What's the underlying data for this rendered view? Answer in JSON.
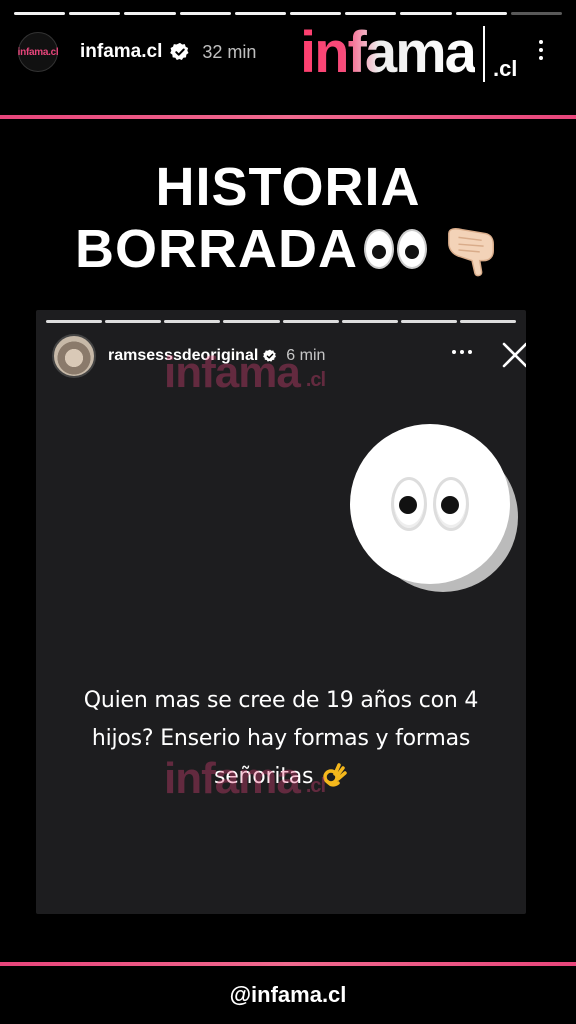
{
  "story": {
    "progress_segments": 10,
    "progress_completed": 9,
    "account": {
      "avatar_text": "infama.cl",
      "username": "infama.cl",
      "verified": true,
      "time": "32 min"
    },
    "brand_logo": {
      "word": "infama",
      "suffix": ".cl"
    },
    "headline": {
      "line1": "HISTORIA",
      "line2": "BORRADA"
    },
    "embedded_story": {
      "progress_segments": 8,
      "username": "ramsesssdeoriginal",
      "verified": true,
      "time": "6 min",
      "watermark_word": "infama",
      "watermark_suffix": ".cl",
      "caption_line1": "Quien mas se cree de 19 años con 4",
      "caption_line2": "hijos? Enserio hay formas y formas",
      "caption_line3": "señoritas"
    },
    "footer_handle": "@infama.cl"
  },
  "colors": {
    "accent": "#e8457b",
    "background": "#000000",
    "card_background": "#1d1d1f"
  },
  "icons": {
    "verified": "verified-badge-icon",
    "more": "more-dots-icon",
    "close": "close-icon",
    "eyes": "eyes-emoji-icon",
    "pointing_hand": "pointing-down-hand-icon",
    "ok_hand": "ok-hand-icon"
  }
}
